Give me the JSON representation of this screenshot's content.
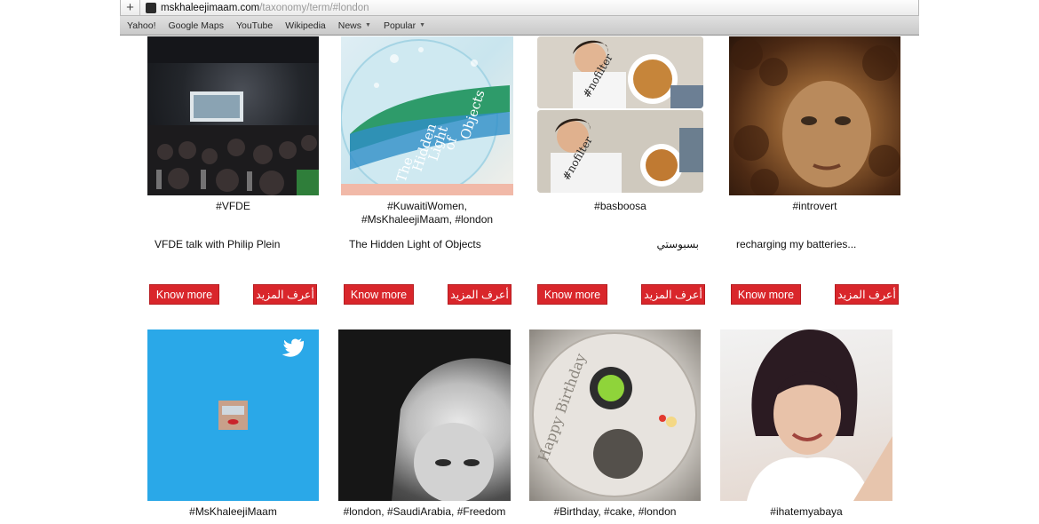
{
  "browser": {
    "url_domain": "mskhaleejimaam.com",
    "url_path": "/taxonomy/term/#london",
    "bookmarks": [
      {
        "label": "Yahoo!"
      },
      {
        "label": "Google Maps"
      },
      {
        "label": "YouTube"
      },
      {
        "label": "Wikipedia"
      },
      {
        "label": "News",
        "dropdown": true
      },
      {
        "label": "Popular",
        "dropdown": true
      }
    ]
  },
  "row1": [
    {
      "caption": "#VFDE",
      "description": "VFDE talk with Philip Plein",
      "know_more": "Know more",
      "learn_more_ar": "أعرف المزيد"
    },
    {
      "caption_line1": "#KuwaitiWomen,",
      "caption_line2": "#MsKhaleejiMaam, #london",
      "description": "The Hidden Light of Objects",
      "book_title_lines": [
        "The",
        "Hidden",
        "Light",
        "of",
        "Objects"
      ],
      "know_more": "Know more",
      "learn_more_ar": "أعرف المزيد"
    },
    {
      "caption": "#basboosa",
      "description": "بسبوستي",
      "shirt_text": "#nofilter",
      "know_more": "Know more",
      "learn_more_ar": "أعرف المزيد"
    },
    {
      "caption": "#introvert",
      "description": "recharging my batteries...",
      "know_more": "Know more",
      "learn_more_ar": "أعرف المزيد"
    }
  ],
  "row2": [
    {
      "caption": "#MsKhaleejiMaam",
      "icon": "twitter-bird-icon"
    },
    {
      "caption": "#london, #SaudiArabia, #Freedom"
    },
    {
      "caption": "#Birthday, #cake, #london",
      "plate_text": "Happy Birthday"
    },
    {
      "caption": "#ihatemyabaya"
    }
  ],
  "colors": {
    "button_red": "#d9262b",
    "twitter_blue": "#2aa8e8"
  }
}
